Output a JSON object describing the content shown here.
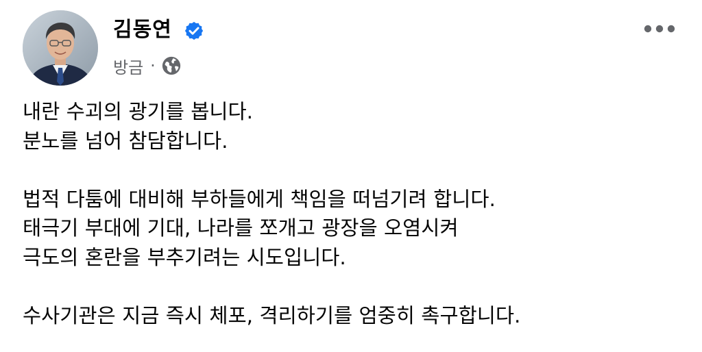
{
  "post": {
    "author": {
      "name": "김동연",
      "verified": true
    },
    "timestamp": "방금",
    "separator": "·",
    "audience_icon": "globe-icon",
    "more_icon": "more-options-icon",
    "colors": {
      "verified_badge": "#1877f2",
      "secondary_text": "#65676b",
      "primary_text": "#050505"
    },
    "lines": [
      "내란 수괴의 광기를 봅니다.",
      "분노를 넘어 참담합니다.",
      "",
      "법적 다툼에 대비해 부하들에게 책임을 떠넘기려 합니다.",
      "태극기 부대에 기대, 나라를 쪼개고 광장을 오염시켜",
      "극도의 혼란을 부추기려는 시도입니다.",
      "",
      "수사기관은 지금 즉시 체포, 격리하기를 엄중히 촉구합니다."
    ]
  }
}
